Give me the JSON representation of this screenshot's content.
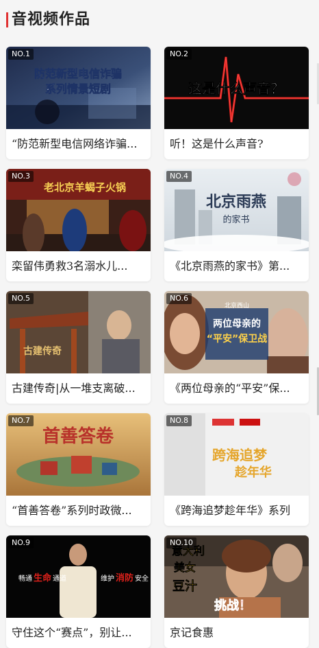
{
  "section": {
    "title": "音视频作品"
  },
  "items": [
    {
      "rank": "NO.1",
      "title": "“防范新型电信网络诈骗...",
      "overlay": [
        "防范新型电信诈骗",
        "系列情景短剧"
      ]
    },
    {
      "rank": "NO.2",
      "title": "听！这是什么声音?",
      "overlay": [
        "这是什么声音？"
      ]
    },
    {
      "rank": "NO.3",
      "title": "栾留伟勇救3名溺水儿...",
      "overlay": [
        "老北京羊蝎子火锅"
      ]
    },
    {
      "rank": "NO.4",
      "title": "《北京雨燕的家书》第...",
      "overlay": [
        "北京雨燕",
        "的家书"
      ]
    },
    {
      "rank": "NO.5",
      "title": "古建传奇|从一堆支离破...",
      "overlay": [
        "古建传奇"
      ]
    },
    {
      "rank": "NO.6",
      "title": "《两位母亲的“平安”保...",
      "overlay": [
        "两位母亲的",
        "“平安”保卫战",
        "北京西山"
      ]
    },
    {
      "rank": "NO.7",
      "title": "“首善答卷”系列时政微...",
      "overlay": [
        "首善答卷"
      ]
    },
    {
      "rank": "NO.8",
      "title": "《跨海追梦趁年华》系列",
      "overlay": [
        "跨海追梦",
        "趁年华"
      ]
    },
    {
      "rank": "NO.9",
      "title": "守住这个“赛点”，别让...",
      "overlay": [
        "畅通",
        "生命",
        "通道",
        "维护",
        "消防",
        "安全"
      ]
    },
    {
      "rank": "NO.10",
      "title": "京记食惠",
      "overlay": [
        "意大利",
        "美女",
        "豆汁",
        "挑战！"
      ]
    }
  ],
  "colors": {
    "accent": "#e03131"
  }
}
